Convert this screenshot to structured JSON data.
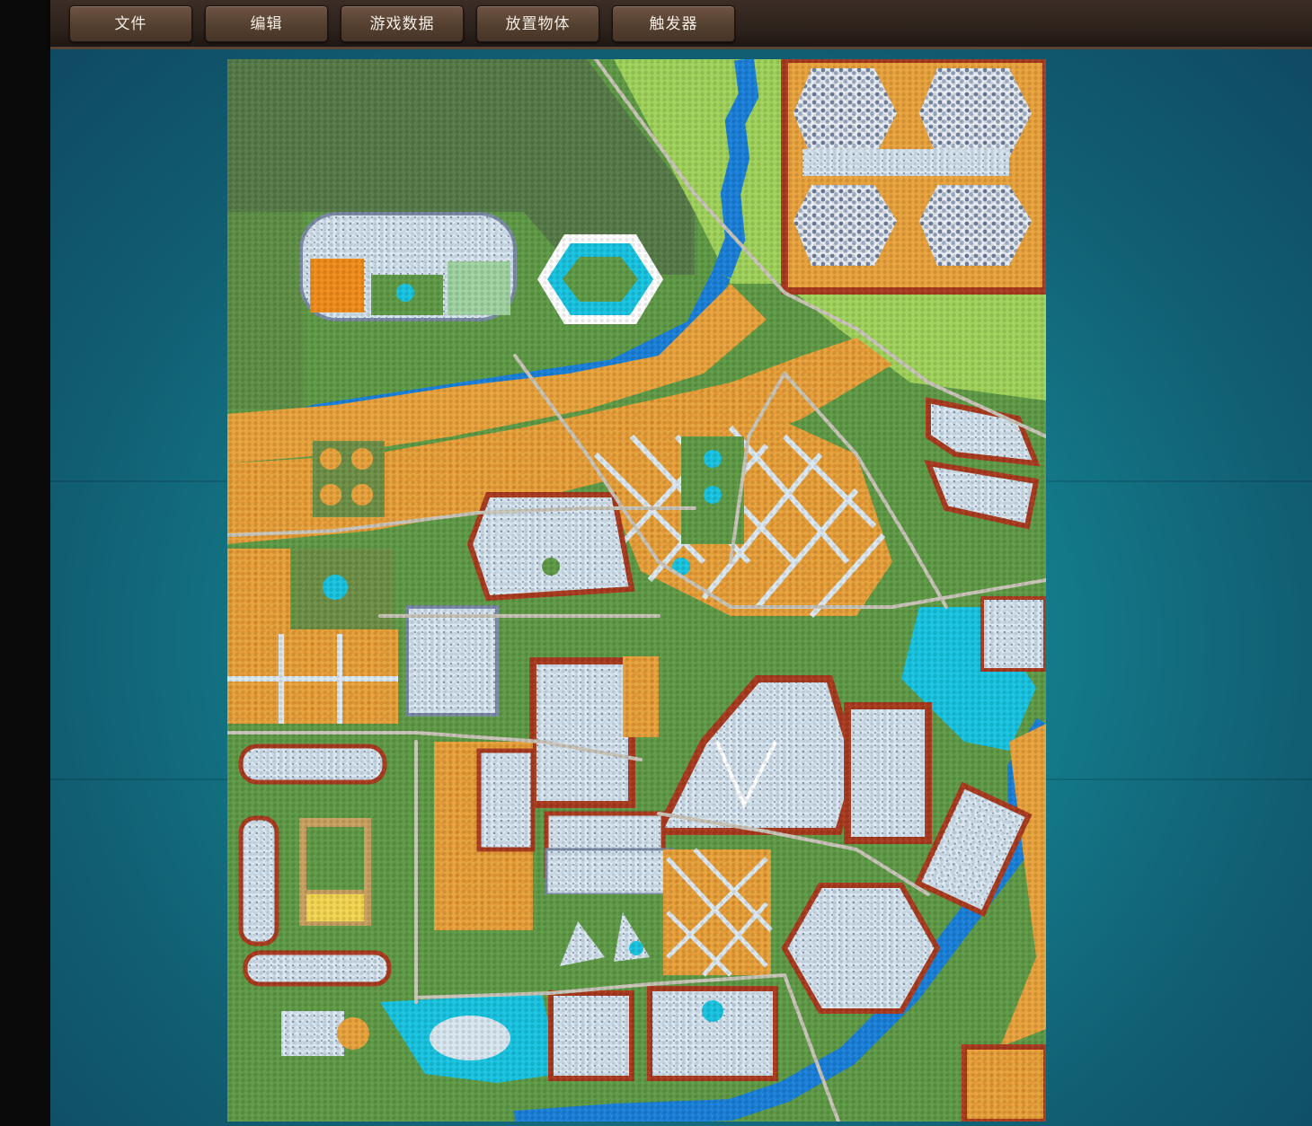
{
  "menu": {
    "items": [
      {
        "label": "文件"
      },
      {
        "label": "编辑"
      },
      {
        "label": "游戏数据"
      },
      {
        "label": "放置物体"
      },
      {
        "label": "触发器"
      }
    ]
  },
  "colors": {
    "grass": "#5f9a46",
    "dark_grass": "#567a48",
    "light_grass": "#9fd25a",
    "sand": "#e8a23c",
    "river": "#1a7fd8",
    "lake": "#18c3e0",
    "snow": "#d8e6ef",
    "road": "#c9c4b8",
    "wall": "#a83a1e",
    "menubar": "#2b201a",
    "workspace": "#14818f"
  }
}
